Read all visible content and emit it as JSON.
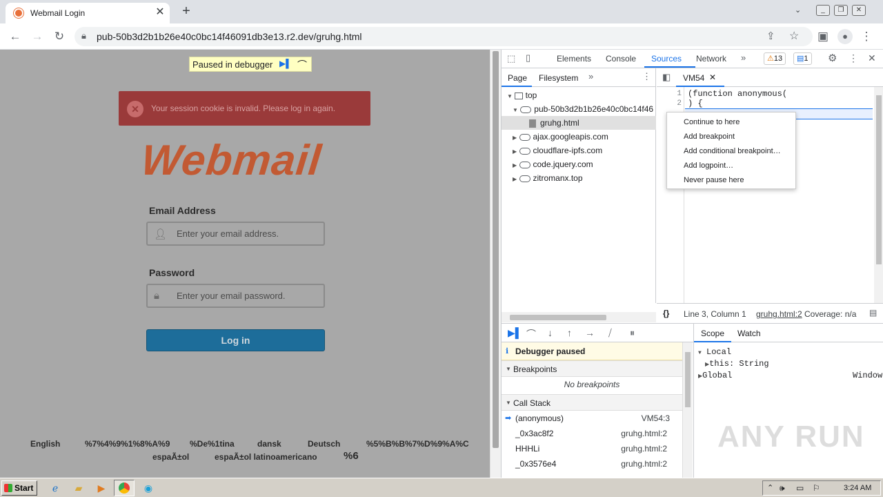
{
  "browser": {
    "tab_title": "Webmail Login",
    "close_label": "✕",
    "new_tab_label": "+",
    "url": "pub-50b3d2b1b26e40c0bc14f46091db3e13.r2.dev/gruhg.html"
  },
  "page": {
    "pause_banner": "Paused in debugger",
    "alert_message": "Your session cookie is invalid. Please log in again.",
    "logo_text": "Webmail",
    "email_label": "Email Address",
    "email_placeholder": "Enter your email address.",
    "password_label": "Password",
    "password_placeholder": "Enter your email password.",
    "login_button": "Log in",
    "languages_row1": [
      "English",
      "%7%4%9%1%8%A%9",
      "%De%1tina",
      "dansk",
      "Deutsch",
      "%5%B%B%7%D%9%A%C"
    ],
    "languages_row2": [
      "espaÃ±ol",
      "espaÃ±ol latinoamericano",
      "%6"
    ]
  },
  "devtools": {
    "tabs": [
      "Elements",
      "Console",
      "Sources",
      "Network"
    ],
    "active_tab": "Sources",
    "warnings_count": "13",
    "messages_count": "1",
    "nav_tabs": [
      "Page",
      "Filesystem"
    ],
    "tree": {
      "top": "top",
      "origin": "pub-50b3d2b1b26e40c0bc14f46",
      "file": "gruhg.html",
      "domains": [
        "ajax.googleapis.com",
        "cloudflare-ipfs.com",
        "code.jquery.com",
        "zitromanx.top"
      ]
    },
    "editor_tab": "VM54",
    "code_lines": [
      "(function anonymous(",
      ") {"
    ],
    "line_numbers": [
      "1",
      "2"
    ],
    "context_menu": [
      "Continue to here",
      "Add breakpoint",
      "Add conditional breakpoint…",
      "Add logpoint…",
      "Never pause here"
    ],
    "status_position": "Line 3, Column 1",
    "status_source": "gruhg.html:2",
    "status_coverage": "Coverage: n/a",
    "debugger_paused": "Debugger paused",
    "breakpoints_title": "Breakpoints",
    "no_breakpoints": "No breakpoints",
    "callstack_title": "Call Stack",
    "call_stack": [
      {
        "name": "(anonymous)",
        "loc": "VM54:3"
      },
      {
        "name": "_0x3ac8f2",
        "loc": "gruhg.html:2"
      },
      {
        "name": "HHHLi",
        "loc": "gruhg.html:2"
      },
      {
        "name": "_0x3576e4",
        "loc": "gruhg.html:2"
      }
    ],
    "scope_tabs": [
      "Scope",
      "Watch"
    ],
    "scope_local": "Local",
    "scope_this_key": "this:",
    "scope_this_val": "String",
    "scope_global": "Global",
    "scope_global_val": "Window"
  },
  "taskbar": {
    "start_label": "Start",
    "clock": "3:24 AM"
  },
  "watermark": "ANY RUN"
}
